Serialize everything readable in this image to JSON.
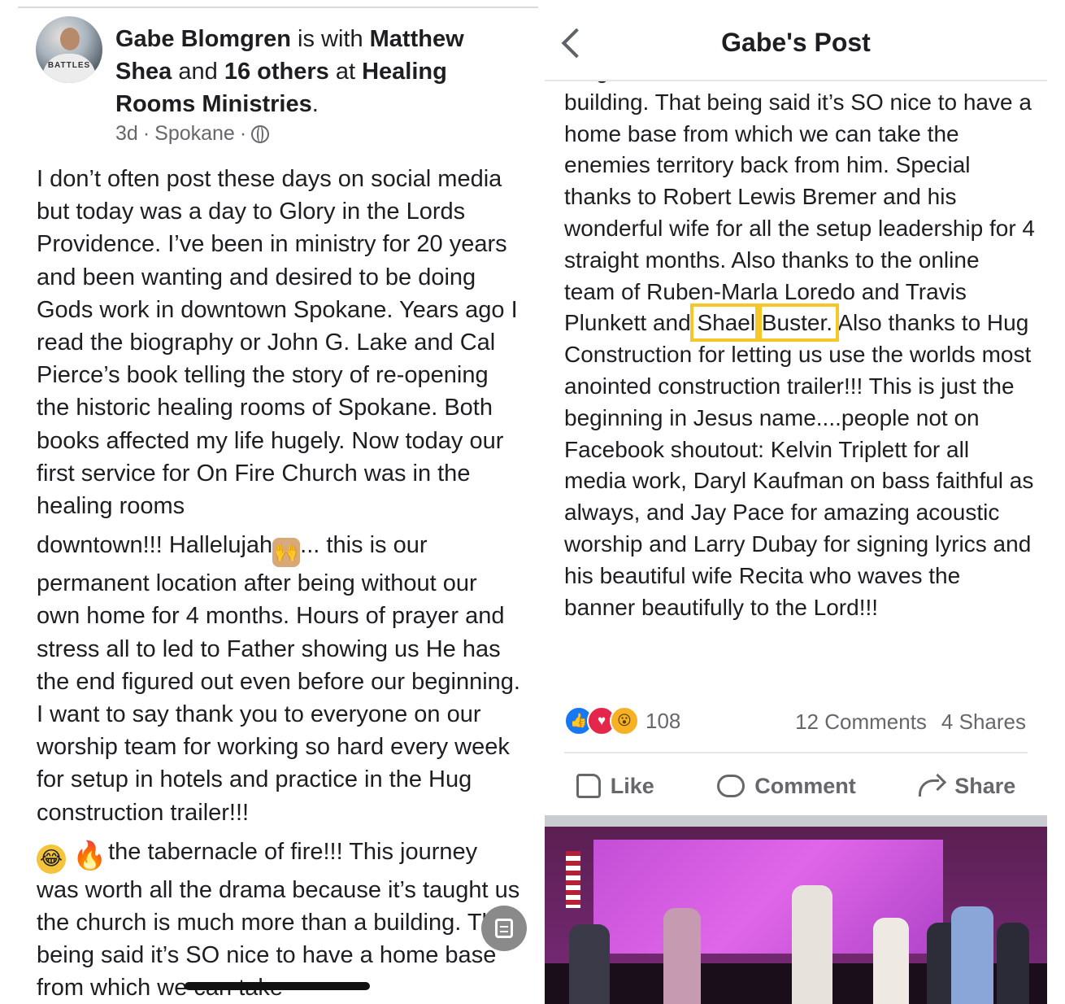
{
  "left_post": {
    "author": "Gabe Blomgren",
    "with_text": " is with ",
    "tagged": "Matthew Shea",
    "and_text": " and ",
    "others": "16 others",
    "at_text": " at ",
    "place": "Healing Rooms Ministries",
    "period": ".",
    "avatar_logo": "BATTLES",
    "time": "3d",
    "dot": "·",
    "location": "Spokane",
    "dot2": "·",
    "para1": "I don’t often post these days on social media but today was a day to Glory in the Lords Providence. I’ve been in ministry for 20 years and been wanting and desired to be doing Gods work in downtown Spokane. Years ago I read the biography or John G. Lake and Cal Pierce’s book telling the story of re-opening the historic healing rooms of Spokane. Both books affected my life hugely. Now today our first service for On Fire Church was in the healing rooms",
    "para2a": "downtown!!! Hallelujah",
    "para2b": "... this is our permanent location after being without our own home for 4 months. Hours of prayer and stress all to led to Father showing us He has the end figured out even before our beginning. I want to say thank you to everyone on our worship team for working so hard every week for setup in hotels and practice in the Hug construction trailer!!!",
    "para3": " the tabernacle of fire!!! This journey was worth all the drama because it’s taught us the church is much more than a building. That being said it’s SO nice to have a home base from which we can take"
  },
  "right_post": {
    "title": "Gabe's Post",
    "text_a": "taught us the church is much more than a building. That being said it’s SO nice to have a home base from which we can take the enemies territory back from him. Special thanks to Robert Lewis Bremer and his wonderful wife for all the setup leadership for 4 straight months. Also thanks to the online team of Ruben-Marla Loredo and Travis Plunkett and ",
    "highlight1": "Shael",
    "space": " ",
    "highlight2": "Buster.",
    "text_b": " Also thanks to Hug Construction for letting us use the worlds most anointed construction trailer!!! This is just the beginning in Jesus name....people not on Facebook shoutout: Kelvin Triplett for all media work, Daryl Kaufman on bass faithful as always, and Jay Pace for amazing acoustic worship and Larry Dubay for signing lyrics and his beautiful wife Recita who waves the banner beautifully to the Lord!!!",
    "reaction_count": "108",
    "comments": "12 Comments",
    "shares": "4 Shares",
    "like_label": "Like",
    "comment_label": "Comment",
    "share_label": "Share",
    "highlight_color": "#f5c728"
  },
  "icons": {
    "back": "chevron-left-icon",
    "globe": "globe-icon",
    "like": "thumbs-up-icon",
    "comment": "comment-bubble-icon",
    "share": "share-arrow-icon",
    "scan": "scan-text-icon"
  }
}
